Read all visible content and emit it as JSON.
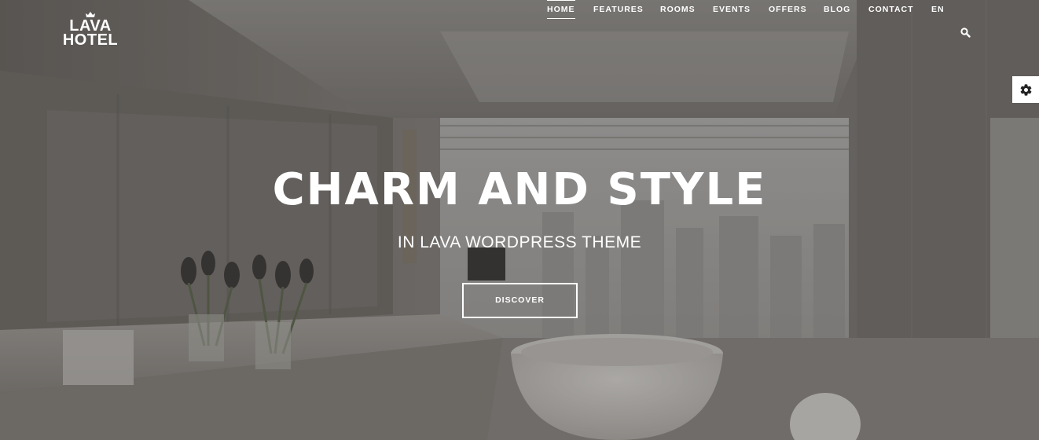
{
  "brand": {
    "line1": "LAVA",
    "line2": "HOTEL",
    "crown_icon": "crown-icon"
  },
  "nav": {
    "items": [
      {
        "label": "HOME",
        "active": true
      },
      {
        "label": "FEATURES",
        "active": false
      },
      {
        "label": "ROOMS",
        "active": false
      },
      {
        "label": "EVENTS",
        "active": false
      },
      {
        "label": "OFFERS",
        "active": false
      },
      {
        "label": "BLOG",
        "active": false
      },
      {
        "label": "CONTACT",
        "active": false
      },
      {
        "label": "EN",
        "active": false
      }
    ],
    "search_icon": "search-icon"
  },
  "hero": {
    "headline": "CHARM AND STYLE",
    "subheadline": "IN LAVA WORDPRESS THEME",
    "cta_label": "DISCOVER"
  },
  "settings": {
    "icon": "gear-icon"
  },
  "colors": {
    "text": "#ffffff",
    "overlay": "#282624",
    "settings_bg": "#ffffff",
    "settings_icon": "#222222"
  }
}
